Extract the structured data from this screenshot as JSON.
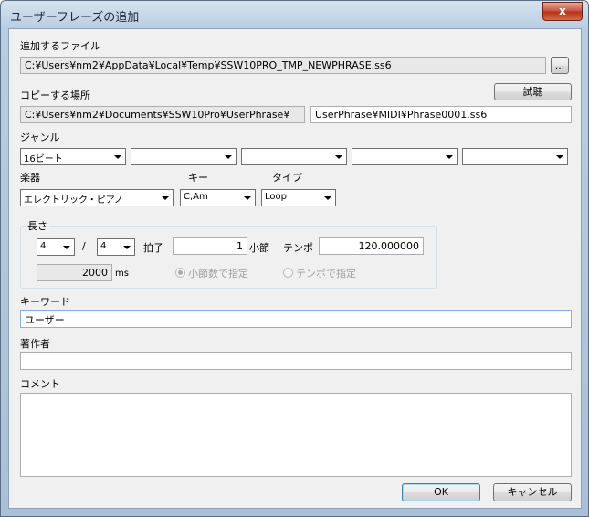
{
  "window": {
    "title": "ユーザーフレーズの追加",
    "close_glyph": "x"
  },
  "source_file": {
    "label": "追加するファイル",
    "path": "C:¥Users¥nm2¥AppData¥Local¥Temp¥SSW10PRO_TMP_NEWPHRASE.ss6",
    "browse_label": "..."
  },
  "copy_dest": {
    "label": "コピーする場所",
    "folder": "C:¥Users¥nm2¥Documents¥SSW10Pro¥UserPhrase¥",
    "file": "UserPhrase¥MIDI¥Phrase0001.ss6",
    "audition_label": "試聴"
  },
  "genre": {
    "label": "ジャンル",
    "values": [
      "16ビート",
      "",
      "",
      "",
      ""
    ]
  },
  "instrument": {
    "label": "楽器",
    "value": "エレクトリック・ピアノ"
  },
  "key": {
    "label": "キー",
    "value": "C,Am"
  },
  "type": {
    "label": "タイプ",
    "value": "Loop"
  },
  "length": {
    "group_label": "長さ",
    "time_sig_num": "4",
    "slash": "/",
    "time_sig_den": "4",
    "beat_label": "拍子",
    "measures": "1",
    "measures_label": "小節",
    "tempo_label": "テンポ",
    "tempo": "120.000000",
    "ms_value": "2000",
    "ms_label": "ms",
    "radio_measures": "小節数で指定",
    "radio_tempo": "テンポで指定"
  },
  "keyword": {
    "label": "キーワード",
    "value": "ユーザー"
  },
  "author": {
    "label": "著作者",
    "value": ""
  },
  "comment": {
    "label": "コメント",
    "value": ""
  },
  "buttons": {
    "ok": "OK",
    "cancel": "キャンセル"
  }
}
